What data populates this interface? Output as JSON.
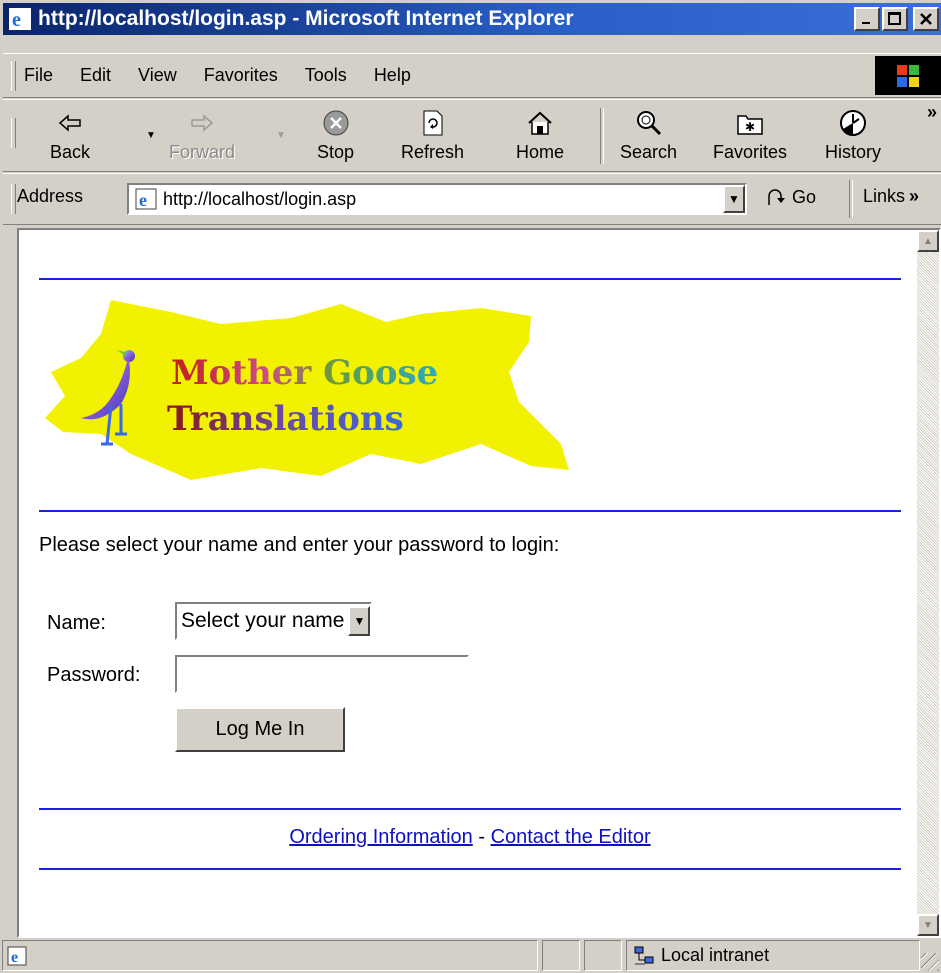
{
  "window": {
    "title": "http://localhost/login.asp - Microsoft Internet Explorer"
  },
  "titlebar_buttons": {
    "minimize": "_",
    "maximize": "□",
    "close": "✕"
  },
  "menu": [
    "File",
    "Edit",
    "View",
    "Favorites",
    "Tools",
    "Help"
  ],
  "toolbar": {
    "back": "Back",
    "forward": "Forward",
    "stop": "Stop",
    "refresh": "Refresh",
    "home": "Home",
    "search": "Search",
    "favorites": "Favorites",
    "history": "History",
    "more": "»"
  },
  "address": {
    "label": "Address",
    "url": "http://localhost/login.asp",
    "go": "Go",
    "links": "Links",
    "links_more": "»"
  },
  "page": {
    "logo_line1": "Mother Goose",
    "logo_line2": "Translations",
    "intro": "Please select your name and enter your password to login:",
    "name_label": "Name:",
    "name_select": "Select your name",
    "password_label": "Password:",
    "password_value": "",
    "login_button": "Log Me In",
    "footer_link1": "Ordering Information",
    "footer_sep": "-",
    "footer_link2": "Contact the Editor"
  },
  "status": {
    "zone": "Local intranet"
  },
  "colors": {
    "titlebar": "#0a246a",
    "rule": "#2020e0",
    "link": "#1010c0",
    "logo_bg": "#f2f200",
    "desktop": "#e9b64a"
  }
}
